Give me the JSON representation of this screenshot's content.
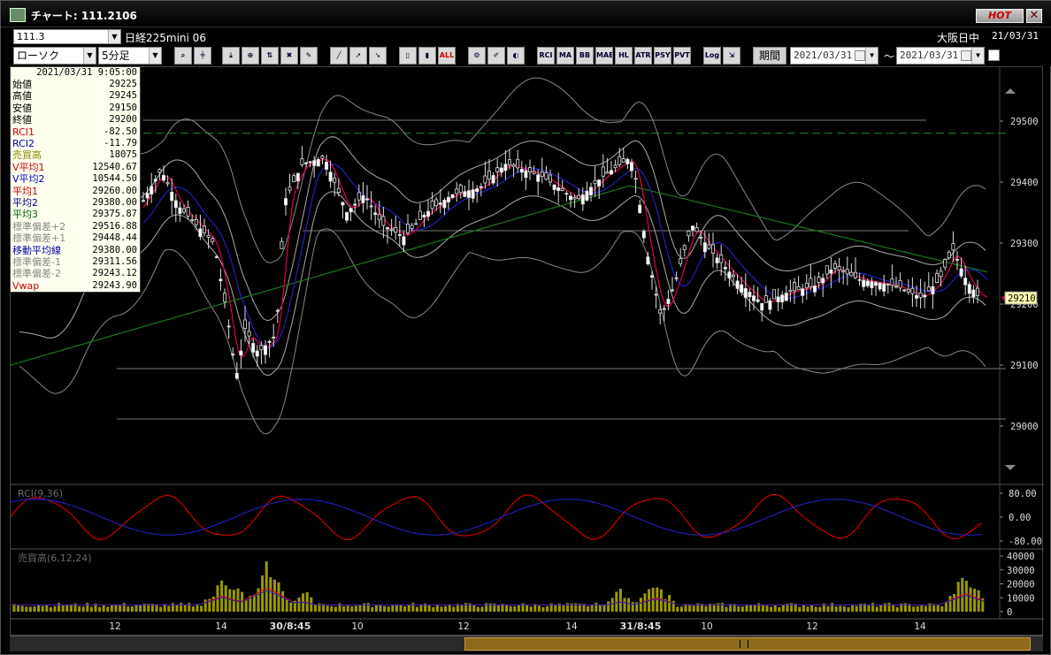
{
  "window": {
    "title": "チャート: 111.2106",
    "hot_label": "HOT",
    "close_label": "✕"
  },
  "toolbar": {
    "symbol_code": "111.3",
    "symbol_name": "日経225mini 06",
    "market": "大阪日中",
    "date": "21/03/31",
    "chart_type": "ローソク",
    "interval": "5分足",
    "buttons": [
      "zoom-icon",
      "crosshair-icon",
      "arrow-down-icon",
      "zoom-fit-icon",
      "compare-icon",
      "eraser-icon",
      "pencil-icon",
      "trend-line-icon",
      "cursor-icon",
      "candle-width-icon",
      "candle-narrow-icon",
      "all-icon",
      "settings-icon",
      "paint-icon",
      "palette-icon",
      "RCI",
      "MA",
      "BB",
      "MAE",
      "HL",
      "ATR",
      "PSY",
      "PVT",
      "Log",
      "export-icon"
    ],
    "button_labels": {
      "all": "ALL",
      "rci": "RCI",
      "ma": "MA",
      "bb": "BB",
      "mae": "MAE",
      "hl": "HL",
      "atr": "ATR",
      "psy": "PSY",
      "pvt": "PVT",
      "log": "Log"
    },
    "period_label": "期間",
    "start_date": "2021/03/31",
    "end_date": "2021/03/31",
    "tilde": "～"
  },
  "info": {
    "datetime": "2021/03/31  9:05:00",
    "rows": [
      {
        "label": "始値",
        "value": "29225",
        "color": "#000000"
      },
      {
        "label": "高値",
        "value": "29245",
        "color": "#000000"
      },
      {
        "label": "安値",
        "value": "29150",
        "color": "#000000"
      },
      {
        "label": "終値",
        "value": "29200",
        "color": "#000000"
      },
      {
        "label": "RCI1",
        "value": "-82.50",
        "color": "#cc0000"
      },
      {
        "label": "RCI2",
        "value": "-11.79",
        "color": "#0000aa"
      },
      {
        "label": "売買高",
        "value": "18075",
        "color": "#8a8a00"
      },
      {
        "label": "V平均1",
        "value": "12540.67",
        "color": "#cc0000"
      },
      {
        "label": "V平均2",
        "value": "10544.50",
        "color": "#0000cc"
      },
      {
        "label": "平均1",
        "value": "29260.00",
        "color": "#cc0000"
      },
      {
        "label": "平均2",
        "value": "29380.00",
        "color": "#000080"
      },
      {
        "label": "平均3",
        "value": "29375.87",
        "color": "#006600"
      },
      {
        "label": "標準偏差+2",
        "value": "29516.88",
        "color": "#888888"
      },
      {
        "label": "標準偏差+1",
        "value": "29448.44",
        "color": "#888888"
      },
      {
        "label": "移動平均線",
        "value": "29380.00",
        "color": "#0000aa"
      },
      {
        "label": "標準偏差-1",
        "value": "29311.56",
        "color": "#888888"
      },
      {
        "label": "標準偏差-2",
        "value": "29243.12",
        "color": "#888888"
      },
      {
        "label": "Vwap",
        "value": "29243.90",
        "color": "#cc0000"
      }
    ]
  },
  "price_axis": {
    "ticks": [
      "29500",
      "29400",
      "29300",
      "29200",
      "29100",
      "29000"
    ],
    "current_price": "29210",
    "dashed_level": 29480
  },
  "rci_panel": {
    "label": "RCI(9,36)",
    "ticks": [
      "80.00",
      "0.00",
      "-80.00"
    ]
  },
  "volume_panel": {
    "label": "売買高(6,12,24)",
    "ticks": [
      "40000",
      "30000",
      "20000",
      "10000",
      "0"
    ]
  },
  "time_axis": {
    "labels": [
      "12",
      "14",
      "30/8:45",
      "10",
      "12",
      "14",
      "31/8:45",
      "10",
      "12",
      "14"
    ]
  },
  "colors": {
    "up": "#ffffff",
    "down": "#000000",
    "ma_red": "#e0004a",
    "ma_blue": "#2020c0",
    "ma_green": "#1a7a1a",
    "bollinger": "#888888",
    "volume": "#9a9a00",
    "dashed": "#2a8a2a"
  }
}
